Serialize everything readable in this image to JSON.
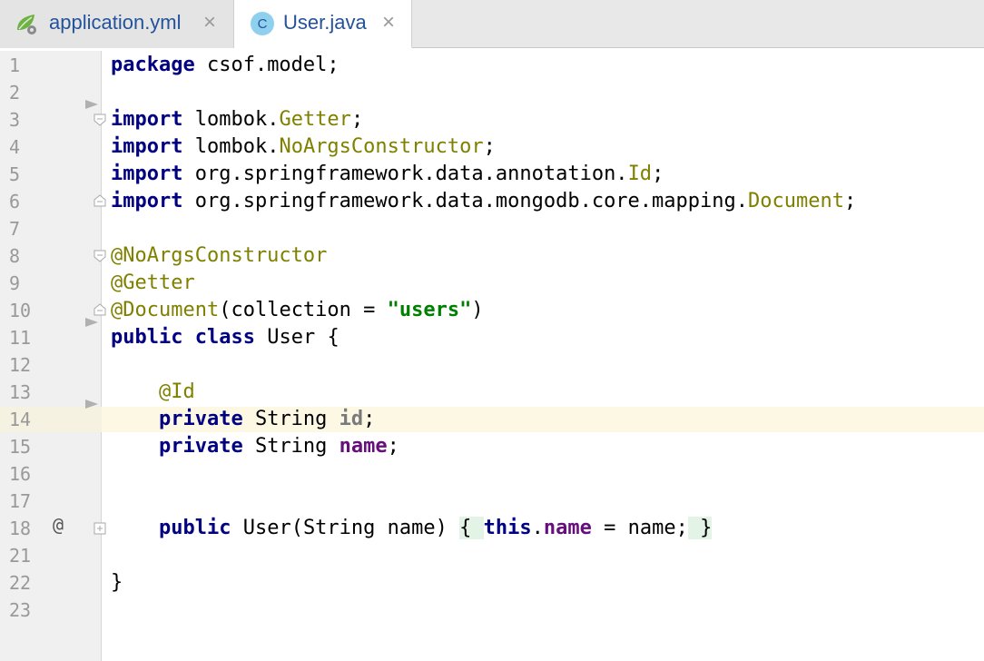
{
  "tabs": [
    {
      "label": "application.yml",
      "icon": "spring-yml-icon",
      "active": false,
      "close": "×"
    },
    {
      "label": "User.java",
      "icon": "java-class-icon",
      "icon_letter": "C",
      "active": true,
      "close": "×"
    }
  ],
  "gutter_marker": "@",
  "code_lines": [
    {
      "n": "1"
    },
    {
      "n": "2"
    },
    {
      "n": "3"
    },
    {
      "n": "4"
    },
    {
      "n": "5"
    },
    {
      "n": "6"
    },
    {
      "n": "7"
    },
    {
      "n": "8"
    },
    {
      "n": "9"
    },
    {
      "n": "10"
    },
    {
      "n": "11"
    },
    {
      "n": "12"
    },
    {
      "n": "13"
    },
    {
      "n": "14"
    },
    {
      "n": "15"
    },
    {
      "n": "16"
    },
    {
      "n": "17"
    },
    {
      "n": "18"
    },
    {
      "n": "21"
    },
    {
      "n": "22"
    },
    {
      "n": "23"
    }
  ],
  "code": {
    "l1_kw": "package",
    "l1_rest": " csof.model;",
    "l3_kw": "import",
    "l3_pkg": " lombok.",
    "l3_cls": "Getter",
    "l3_end": ";",
    "l4_kw": "import",
    "l4_pkg": " lombok.",
    "l4_cls": "NoArgsConstructor",
    "l4_end": ";",
    "l5_kw": "import",
    "l5_pkg": " org.springframework.data.annotation.",
    "l5_cls": "Id",
    "l5_end": ";",
    "l6_kw": "import",
    "l6_pkg": " org.springframework.data.mongodb.core.mapping.",
    "l6_cls": "Document",
    "l6_end": ";",
    "l8_ann": "@NoArgsConstructor",
    "l9_ann": "@Getter",
    "l10_ann": "@Document",
    "l10_mid": "(collection = ",
    "l10_str": "\"users\"",
    "l10_end": ")",
    "l11_kw1": "public",
    "l11_kw2": "class",
    "l11_rest": " User {",
    "l13_ann": "@Id",
    "l14_kw": "private",
    "l14_type": " String ",
    "l14_fld": "id",
    "l14_end": ";",
    "l15_kw": "private",
    "l15_type": " String ",
    "l15_fld": "name",
    "l15_end": ";",
    "l18_kw": "public",
    "l18_sig": " User(String name) ",
    "l18_ob": "{ ",
    "l18_this": "this",
    "l18_dot": ".",
    "l18_fld": "name",
    "l18_assign": " = name;",
    "l18_cb": " }",
    "l22_brace": "}"
  },
  "colors": {
    "keyword": "#000080",
    "annotation": "#808000",
    "string": "#008000",
    "field": "#660e7a",
    "current_line": "#fdf8e4",
    "tab_text": "#24529b"
  }
}
